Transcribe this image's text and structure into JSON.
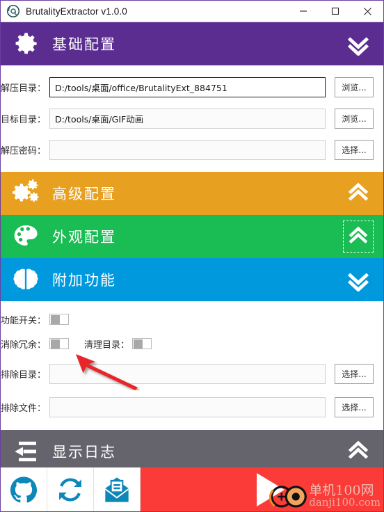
{
  "window": {
    "title": "BrutalityExtractor v1.0.0",
    "app_icon": "at-circle-icon",
    "controls": {
      "minimize": "─",
      "maximize": "☐",
      "close": "✕"
    }
  },
  "colors": {
    "basic": "#5C2D91",
    "advanced": "#E8A020",
    "appearance": "#1ABC54",
    "extra": "#0099DD",
    "log": "#65636C",
    "run": "#FA3B38",
    "tool_icon": "#0C87B8"
  },
  "sections": {
    "basic": {
      "title": "基础配置",
      "icon": "gear-icon",
      "chevron": "chevron-double-down-icon",
      "expanded": true,
      "fields": [
        {
          "label": "解压目录：",
          "value": "D:/tools/桌面/office/BrutalityExt_884751",
          "placeholder": "",
          "button": "浏览...",
          "focused": true
        },
        {
          "label": "目标目录：",
          "value": "D:/tools/桌面/GIF动画",
          "placeholder": "",
          "button": "浏览...",
          "focused": false
        },
        {
          "label": "解压密码：",
          "value": "",
          "placeholder": "",
          "button": "选择...",
          "focused": false
        }
      ]
    },
    "advanced": {
      "title": "高级配置",
      "icon": "gears-icon",
      "chevron": "chevron-double-up-icon",
      "expanded": false
    },
    "appearance": {
      "title": "外观配置",
      "icon": "palette-icon",
      "chevron": "chevron-double-up-icon",
      "expanded": false,
      "chevron_focused": true
    },
    "extra": {
      "title": "附加功能",
      "icon": "brain-icon",
      "chevron": "chevron-double-down-icon",
      "expanded": true,
      "toggles_row1": [
        {
          "label": "功能开关：",
          "state": "off"
        }
      ],
      "toggles_row2": [
        {
          "label": "消除冗余：",
          "state": "off"
        },
        {
          "label": "清理目录：",
          "state": "off"
        }
      ],
      "fields": [
        {
          "label": "排除目录：",
          "value": "",
          "placeholder": "",
          "button": "选择..."
        },
        {
          "label": "排除文件：",
          "value": "",
          "placeholder": "",
          "button": "选择..."
        }
      ]
    },
    "log": {
      "title": "显示日志",
      "icon": "indent-left-icon",
      "chevron": "chevron-double-up-icon",
      "expanded": false
    }
  },
  "toolbar": {
    "buttons": [
      {
        "name": "github-icon",
        "tooltip": ""
      },
      {
        "name": "refresh-icon",
        "tooltip": ""
      },
      {
        "name": "mail-icon",
        "tooltip": ""
      }
    ],
    "run": {
      "icon": "play-icon"
    }
  },
  "watermark": {
    "logo": "danji-logo-icon",
    "cn": "单机100网",
    "en": "danji100.com"
  },
  "annotation": {
    "arrow": "red-arrow-pointer"
  }
}
